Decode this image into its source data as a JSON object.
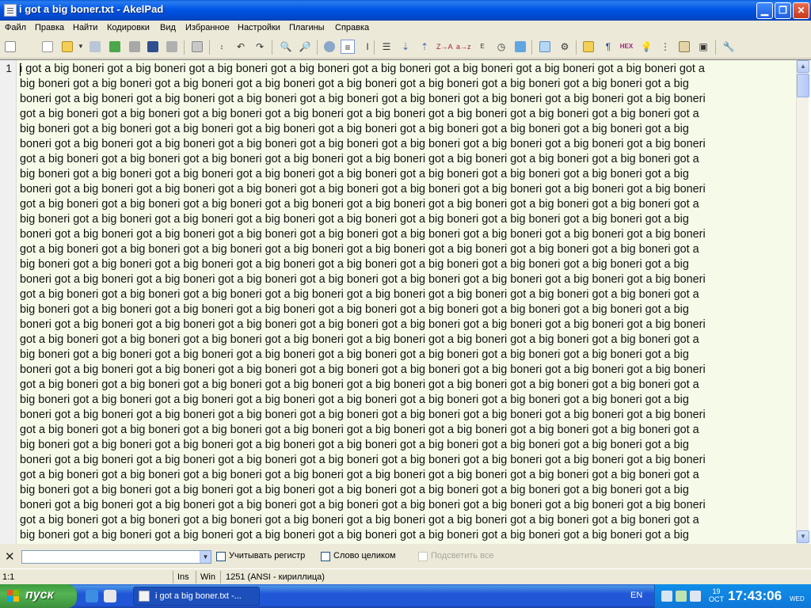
{
  "window": {
    "title": "i got a big boner.txt - AkelPad"
  },
  "menu": [
    "Файл",
    "Правка",
    "Найти",
    "Кодировки",
    "Вид",
    "Избранное",
    "Настройки",
    "Плагины",
    "Справка"
  ],
  "editor": {
    "line_number": "1",
    "lines": [
      "i got a big boneri got a big boneri got a big boneri got a big boneri got a big boneri got a big boneri got a big boneri got a big boneri got a",
      "big boneri got a big boneri got a big boneri got a big boneri got a big boneri got a big boneri got a big boneri got a big boneri got a big",
      "boneri got a big boneri got a big boneri got a big boneri got a big boneri got a big boneri got a big boneri got a big boneri got a big boneri",
      "got a big boneri got a big boneri got a big boneri got a big boneri got a big boneri got a big boneri got a big boneri got a big boneri got a",
      "big boneri got a big boneri got a big boneri got a big boneri got a big boneri got a big boneri got a big boneri got a big boneri got a big",
      "boneri got a big boneri got a big boneri got a big boneri got a big boneri got a big boneri got a big boneri got a big boneri got a big boneri",
      "got a big boneri got a big boneri got a big boneri got a big boneri got a big boneri got a big boneri got a big boneri got a big boneri got a",
      "big boneri got a big boneri got a big boneri got a big boneri got a big boneri got a big boneri got a big boneri got a big boneri got a big",
      "boneri got a big boneri got a big boneri got a big boneri got a big boneri got a big boneri got a big boneri got a big boneri got a big boneri",
      "got a big boneri got a big boneri got a big boneri got a big boneri got a big boneri got a big boneri got a big boneri got a big boneri got a",
      "big boneri got a big boneri got a big boneri got a big boneri got a big boneri got a big boneri got a big boneri got a big boneri got a big",
      "boneri got a big boneri got a big boneri got a big boneri got a big boneri got a big boneri got a big boneri got a big boneri got a big boneri",
      "got a big boneri got a big boneri got a big boneri got a big boneri got a big boneri got a big boneri got a big boneri got a big boneri got a",
      "big boneri got a big boneri got a big boneri got a big boneri got a big boneri got a big boneri got a big boneri got a big boneri got a big",
      "boneri got a big boneri got a big boneri got a big boneri got a big boneri got a big boneri got a big boneri got a big boneri got a big boneri",
      "got a big boneri got a big boneri got a big boneri got a big boneri got a big boneri got a big boneri got a big boneri got a big boneri got a",
      "big boneri got a big boneri got a big boneri got a big boneri got a big boneri got a big boneri got a big boneri got a big boneri got a big",
      "boneri got a big boneri got a big boneri got a big boneri got a big boneri got a big boneri got a big boneri got a big boneri got a big boneri",
      "got a big boneri got a big boneri got a big boneri got a big boneri got a big boneri got a big boneri got a big boneri got a big boneri got a",
      "big boneri got a big boneri got a big boneri got a big boneri got a big boneri got a big boneri got a big boneri got a big boneri got a big",
      "boneri got a big boneri got a big boneri got a big boneri got a big boneri got a big boneri got a big boneri got a big boneri got a big boneri",
      "got a big boneri got a big boneri got a big boneri got a big boneri got a big boneri got a big boneri got a big boneri got a big boneri got a",
      "big boneri got a big boneri got a big boneri got a big boneri got a big boneri got a big boneri got a big boneri got a big boneri got a big",
      "boneri got a big boneri got a big boneri got a big boneri got a big boneri got a big boneri got a big boneri got a big boneri got a big boneri",
      "got a big boneri got a big boneri got a big boneri got a big boneri got a big boneri got a big boneri got a big boneri got a big boneri got a",
      "big boneri got a big boneri got a big boneri got a big boneri got a big boneri got a big boneri got a big boneri got a big boneri got a big",
      "boneri got a big boneri got a big boneri got a big boneri got a big boneri got a big boneri got a big boneri got a big boneri got a big boneri",
      "got a big boneri got a big boneri got a big boneri got a big boneri got a big boneri got a big boneri got a big boneri got a big boneri got a",
      "big boneri got a big boneri got a big boneri got a big boneri got a big boneri got a big boneri got a big boneri got a big boneri got a big",
      "boneri got a big boneri got a big boneri got a big boneri got a big boneri got a big boneri got a big boneri got a big boneri got a big boneri",
      "got a big boneri got a big boneri got a big boneri got a big boneri got a big boneri got a big boneri got a big boneri got a big boneri got a",
      "big boneri got a big boneri got a big boneri got a big boneri got a big boneri got a big boneri got a big boneri got a big boneri got a big"
    ]
  },
  "findbar": {
    "match_case_label": "Учитывать регистр",
    "whole_word_label": "Слово целиком",
    "highlight_all_label": "Подсветить все"
  },
  "statusbar": {
    "position": "1:1",
    "insert_mode": "Ins",
    "newline": "Win",
    "encoding": "1251  (ANSI - кириллица)"
  },
  "taskbar": {
    "start_label": "пуск",
    "task_label": "i got a big boner.txt -...",
    "language": "EN",
    "date_day": "19",
    "date_month": "OCT",
    "time": "17:43:06",
    "weekday": "WED"
  },
  "colors": {
    "editor_background": "#f5fbe8",
    "titlebar": "#0055e5",
    "taskbar": "#2157d7",
    "start_button": "#54b454"
  }
}
